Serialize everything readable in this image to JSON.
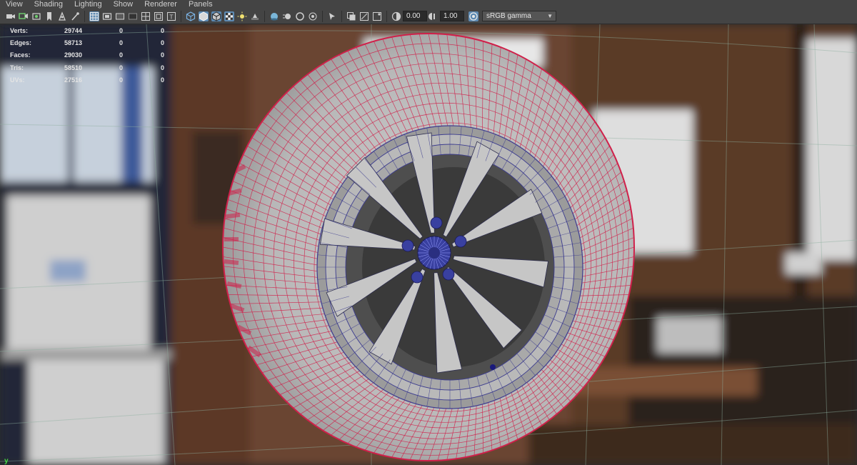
{
  "menu": [
    "View",
    "Shading",
    "Lighting",
    "Show",
    "Renderer",
    "Panels"
  ],
  "toolbar": {
    "exposure": "0.00",
    "gamma": "1.00",
    "color_space": "sRGB gamma"
  },
  "hud": {
    "rows": [
      {
        "label": "Verts:",
        "value": "29744",
        "c1": "0",
        "c2": "0"
      },
      {
        "label": "Edges:",
        "value": "58713",
        "c1": "0",
        "c2": "0"
      },
      {
        "label": "Faces:",
        "value": "29030",
        "c1": "0",
        "c2": "0"
      },
      {
        "label": "Tris:",
        "value": "58510",
        "c1": "0",
        "c2": "0"
      },
      {
        "label": "UVs:",
        "value": "27516",
        "c1": "0",
        "c2": "0"
      }
    ]
  },
  "axis": {
    "label": "y"
  },
  "colors": {
    "tire_wire": "#d0204a",
    "rim_wire": "#3d3d8f",
    "selection": "#5d8ab3",
    "mesh_fill": "#bdbdbd"
  },
  "icons": [
    "camera-icon",
    "camera-attr-icon",
    "bookmark-icon",
    "image-plane-icon",
    "grid-icon",
    "film-gate-icon",
    "resolution-gate-icon",
    "safe-area-icon",
    "wireframe-icon",
    "smooth-shade-icon",
    "textured-icon",
    "lights-icon",
    "shadows-icon",
    "ambient-occlusion-icon",
    "isolate-icon",
    "xray-icon",
    "exposure-icon",
    "gamma-icon",
    "color-management-icon"
  ]
}
